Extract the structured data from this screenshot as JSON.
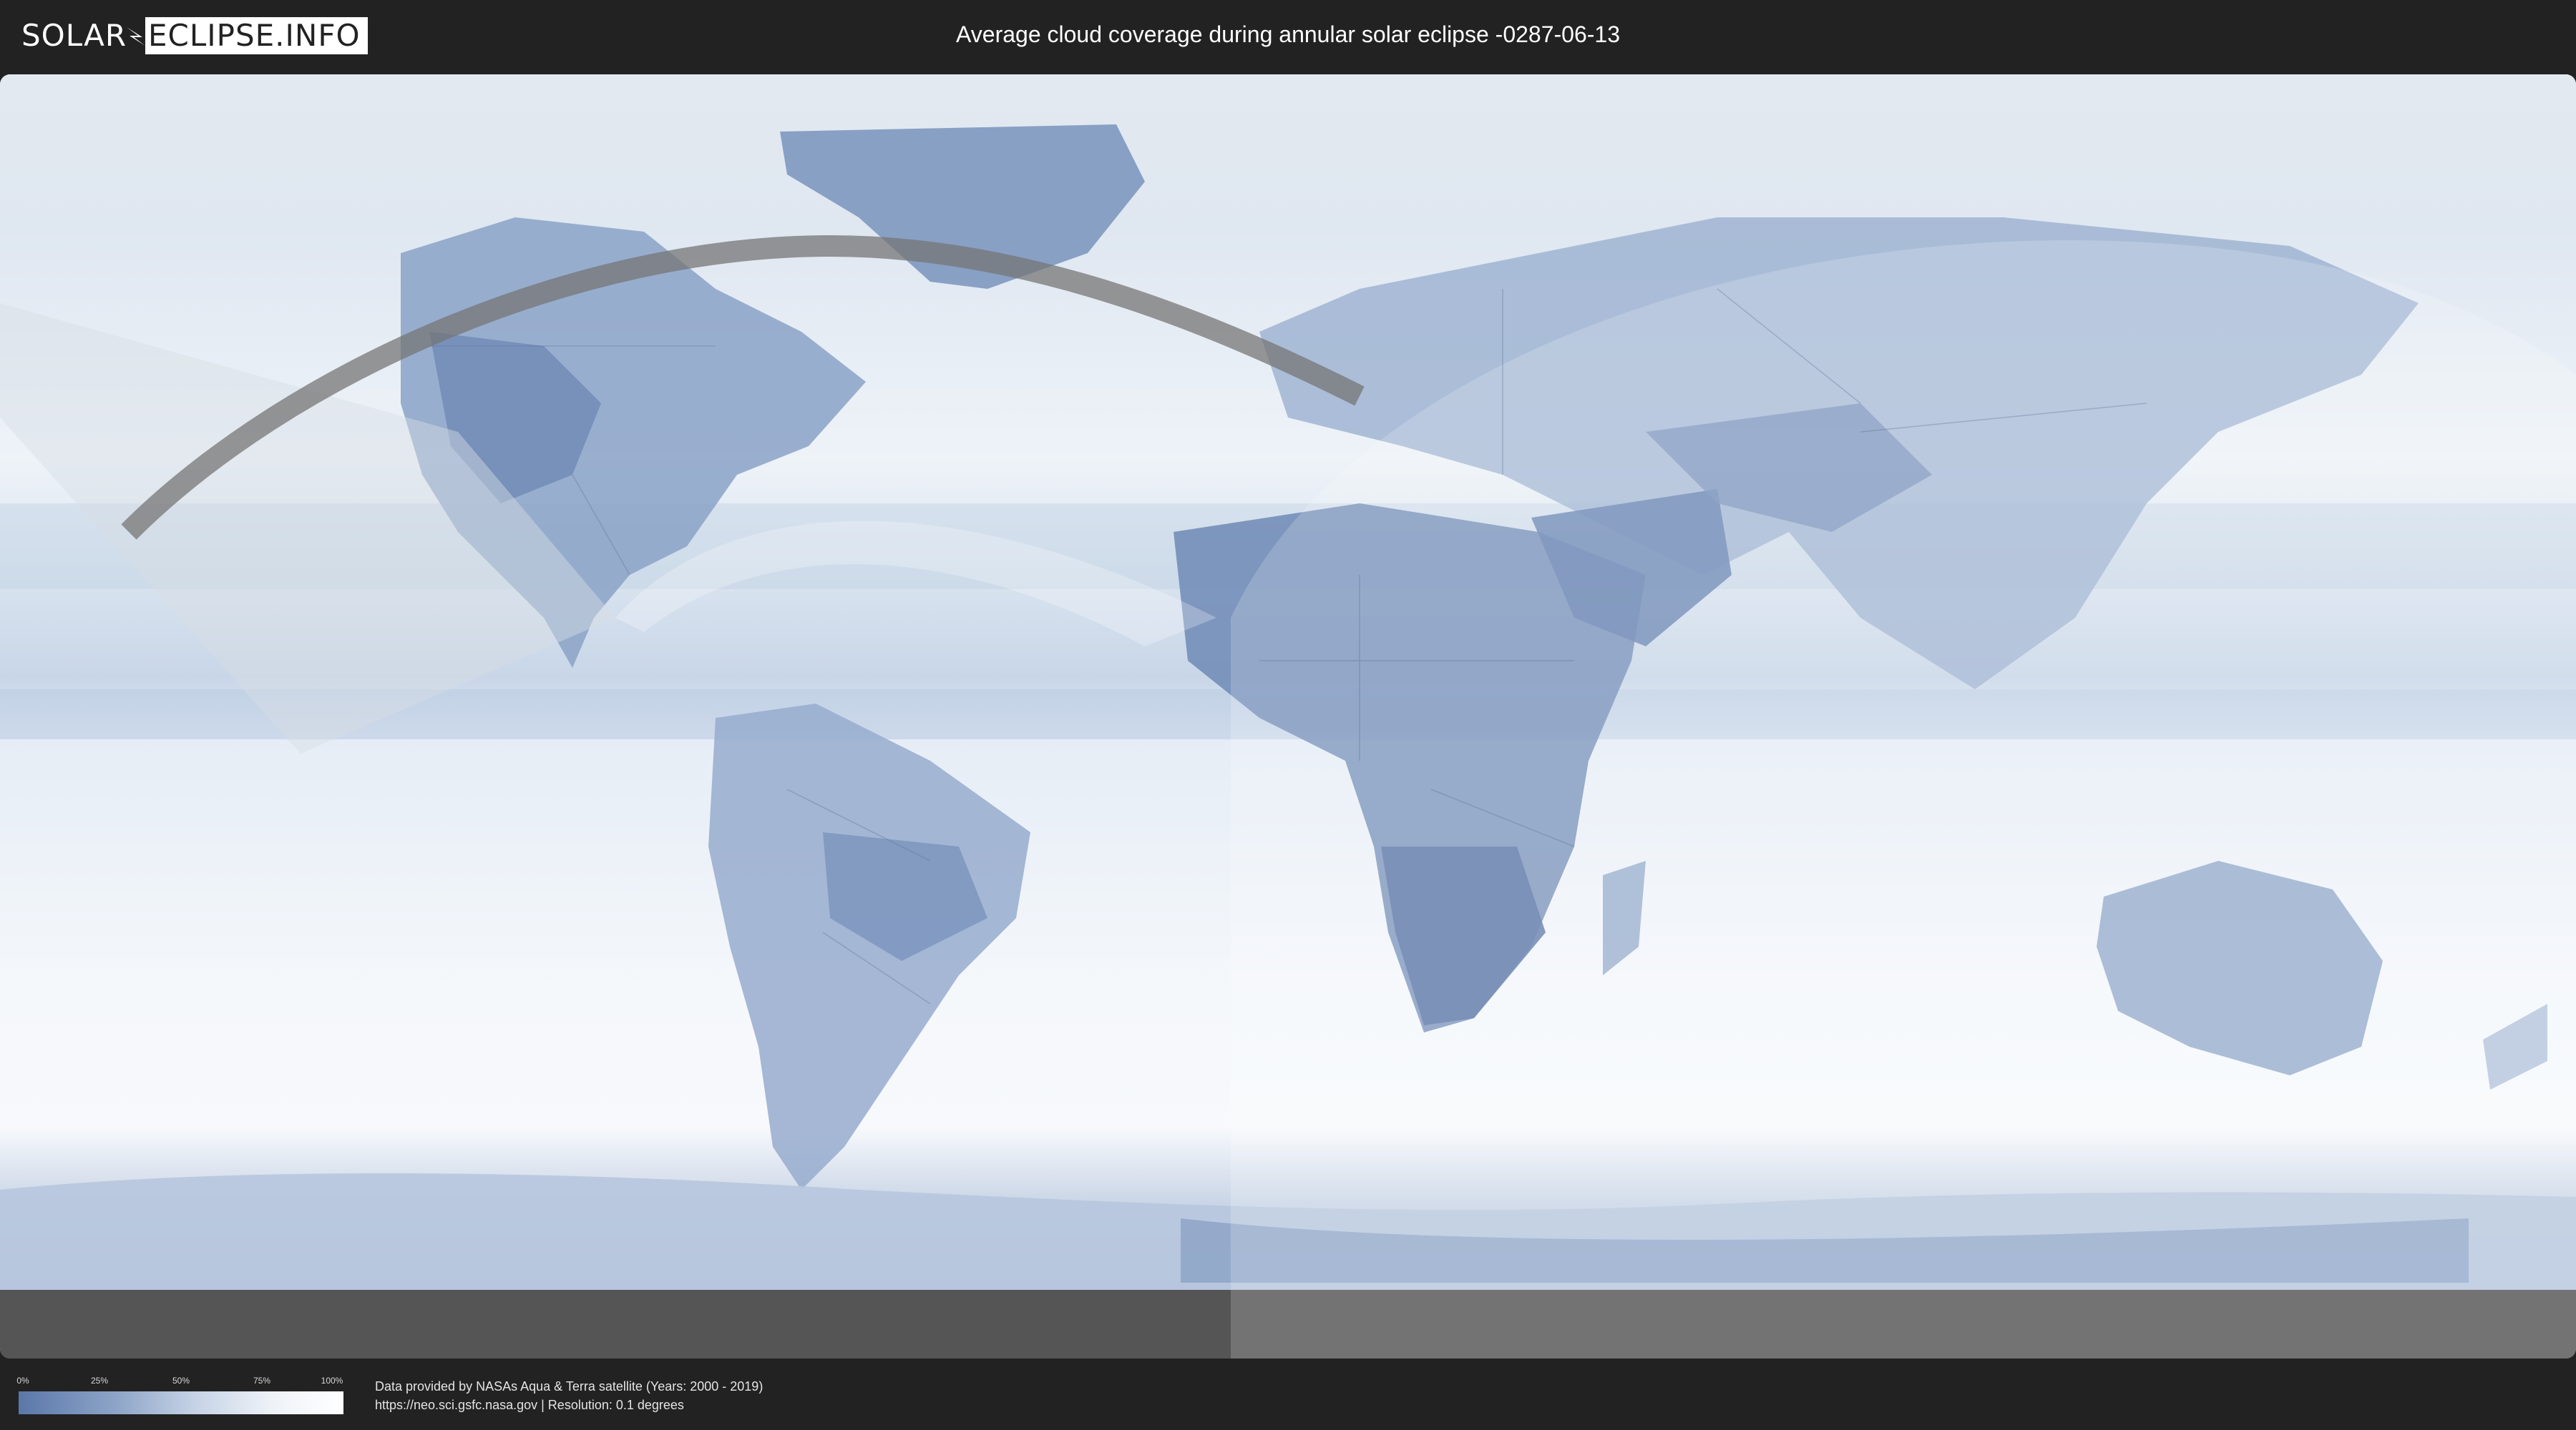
{
  "header": {
    "logo_left": "SOLAR",
    "logo_right": "ECLIPSE.INFO",
    "title": "Average cloud coverage during annular solar eclipse -0287-06-13"
  },
  "legend": {
    "ticks": [
      "0%",
      "25%",
      "50%",
      "75%",
      "100%"
    ],
    "tick_fractions": [
      0,
      0.25,
      0.5,
      0.75,
      1.0
    ]
  },
  "credits": {
    "line1": "Data provided by NASAs Aqua & Terra satellite (Years: 2000 - 2019)",
    "line2": "https://neo.sci.gsfc.nasa.gov | Resolution: 0.1 degrees"
  },
  "colors": {
    "background": "#222222",
    "cloud_clear": "#ffffff",
    "cloud_land": "#5a77a9",
    "eclipse_path": "#7c7c7c",
    "visibility_zone": "#e9eef5"
  },
  "icons": {
    "logo": "eclipse-logo-icon"
  }
}
